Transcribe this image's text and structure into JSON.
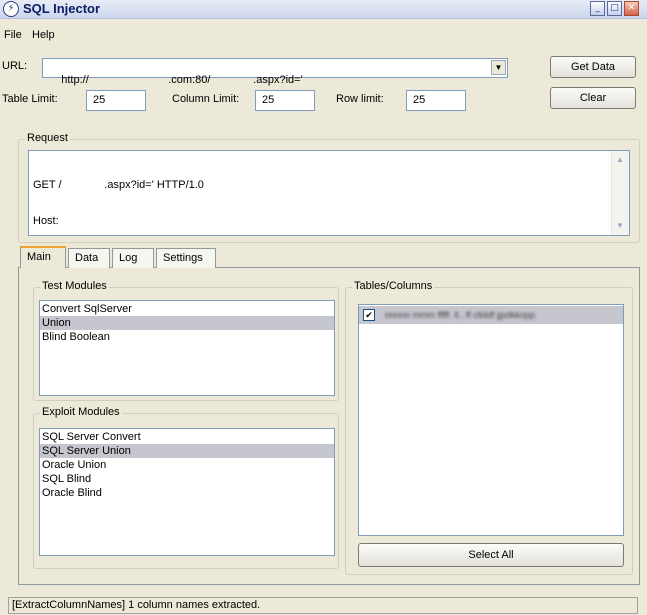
{
  "window": {
    "title": "SQL Injector",
    "minimize": "_",
    "maximize": "□",
    "close": "✕",
    "icon": "lightning-icon"
  },
  "menu": [
    {
      "label": "File"
    },
    {
      "label": "Help"
    }
  ],
  "url": {
    "label": "URL:",
    "value": "http://                          .com:80/              .aspx?id='"
  },
  "limits": {
    "table_label": "Table Limit:",
    "table_value": "25",
    "column_label": "Column Limit:",
    "column_value": "25",
    "row_label": "Row limit:",
    "row_value": "25"
  },
  "buttons": {
    "get_data": "Get Data",
    "clear": "Clear",
    "select_all": "Select All"
  },
  "request": {
    "title": "Request",
    "line1": "GET /              .aspx?id=' HTTP/1.0",
    "line2": "Host:"
  },
  "tabs": [
    {
      "label": "Main"
    },
    {
      "label": "Data"
    },
    {
      "label": "Log"
    },
    {
      "label": "Settings"
    }
  ],
  "test_modules": {
    "title": "Test Modules",
    "items": [
      "Convert SqlServer",
      "Union",
      "Blind Boolean"
    ],
    "selected": 1
  },
  "exploit_modules": {
    "title": "Exploit Modules",
    "items": [
      "SQL Server Convert",
      "SQL Server Union",
      "Oracle Union",
      "SQL Blind",
      "Oracle Blind"
    ],
    "selected": 1
  },
  "tables": {
    "title": "Tables/Columns",
    "row_text": "nnnnn mmm  fffff. ll..   ff cllddf   jjpdkkopp.",
    "checked": true
  },
  "status": {
    "text": "[ExtractColumnNames] 1 column names extracted."
  }
}
